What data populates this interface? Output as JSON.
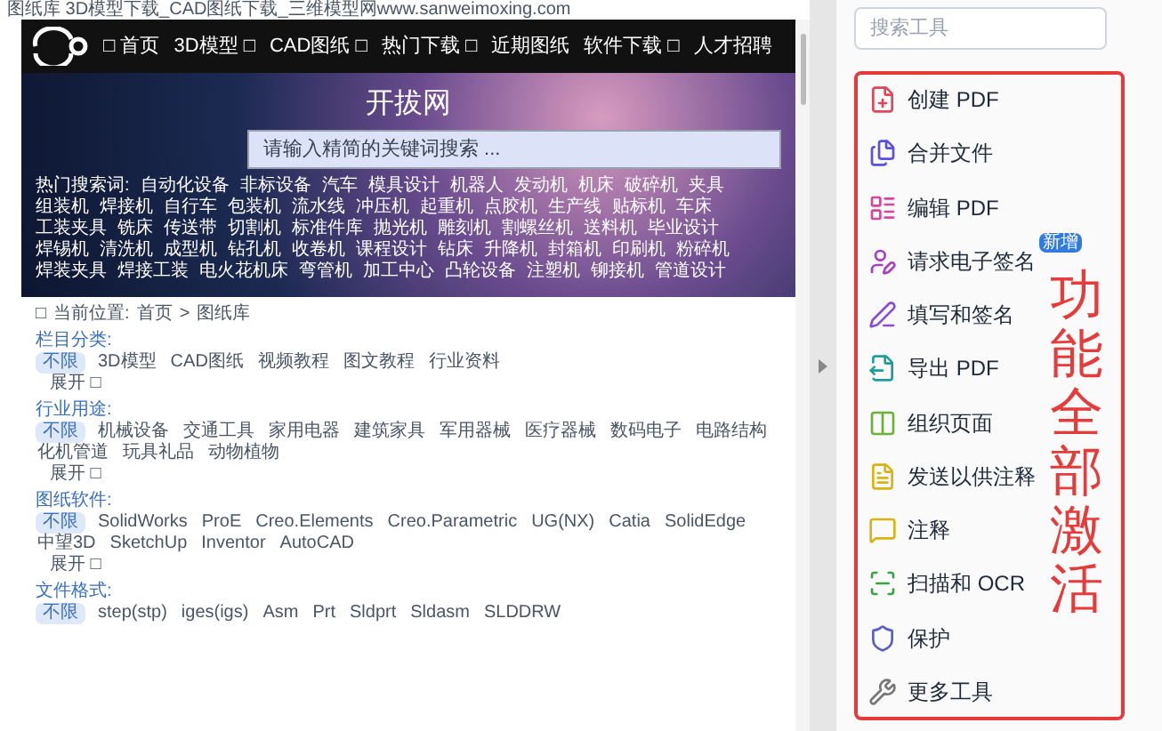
{
  "page_title": "图纸库 3D模型下载_CAD图纸下载_三维模型网www.sanweimoxing.com",
  "nav_items": [
    "□ 首页",
    "3D模型 □",
    "CAD图纸 □",
    "热门下载 □",
    "近期图纸",
    "软件下载 □",
    "人才招聘"
  ],
  "banner_title": "开拔网",
  "search": {
    "placeholder": "请输入精简的关键词搜索 ..."
  },
  "hot_search": {
    "label": "热门搜索词:",
    "terms": [
      "自动化设备",
      "非标设备",
      "汽车",
      "模具设计",
      "机器人",
      "发动机",
      "机床",
      "破碎机",
      "夹具",
      "组装机",
      "焊接机",
      "自行车",
      "包装机",
      "流水线",
      "冲压机",
      "起重机",
      "点胶机",
      "生产线",
      "贴标机",
      "车床",
      "工装夹具",
      "铣床",
      "传送带",
      "切割机",
      "标准件库",
      "抛光机",
      "雕刻机",
      "割螺丝机",
      "送料机",
      "毕业设计",
      "焊锡机",
      "清洗机",
      "成型机",
      "钻孔机",
      "收卷机",
      "课程设计",
      "钻床",
      "升降机",
      "封箱机",
      "印刷机",
      "粉碎机",
      "焊装夹具",
      "焊接工装",
      "电火花机床",
      "弯管机",
      "加工中心",
      "凸轮设备",
      "注塑机",
      "铆接机",
      "管道设计"
    ]
  },
  "breadcrumb": {
    "icon": "□",
    "label": "当前位置:",
    "items": [
      "首页",
      "图纸库"
    ],
    "separator": ">"
  },
  "filters": [
    {
      "title": "栏目分类:",
      "expand": "展开 □",
      "options": [
        {
          "label": "不限",
          "selected": true
        },
        {
          "label": "3D模型",
          "selected": false
        },
        {
          "label": "CAD图纸",
          "selected": false
        },
        {
          "label": "视频教程",
          "selected": false
        },
        {
          "label": "图文教程",
          "selected": false
        },
        {
          "label": "行业资料",
          "selected": false
        }
      ]
    },
    {
      "title": "行业用途:",
      "expand": "展开 □",
      "options": [
        {
          "label": "不限",
          "selected": true
        },
        {
          "label": "机械设备",
          "selected": false
        },
        {
          "label": "交通工具",
          "selected": false
        },
        {
          "label": "家用电器",
          "selected": false
        },
        {
          "label": "建筑家具",
          "selected": false
        },
        {
          "label": "军用器械",
          "selected": false
        },
        {
          "label": "医疗器械",
          "selected": false
        },
        {
          "label": "数码电子",
          "selected": false
        },
        {
          "label": "电路结构",
          "selected": false
        },
        {
          "label": "化机管道",
          "selected": false
        },
        {
          "label": "玩具礼品",
          "selected": false
        },
        {
          "label": "动物植物",
          "selected": false
        }
      ]
    },
    {
      "title": "图纸软件:",
      "expand": "展开 □",
      "options": [
        {
          "label": "不限",
          "selected": true
        },
        {
          "label": "SolidWorks",
          "selected": false
        },
        {
          "label": "ProE",
          "selected": false
        },
        {
          "label": "Creo.Elements",
          "selected": false
        },
        {
          "label": "Creo.Parametric",
          "selected": false
        },
        {
          "label": "UG(NX)",
          "selected": false
        },
        {
          "label": "Catia",
          "selected": false
        },
        {
          "label": "SolidEdge",
          "selected": false
        },
        {
          "label": "中望3D",
          "selected": false
        },
        {
          "label": "SketchUp",
          "selected": false
        },
        {
          "label": "Inventor",
          "selected": false
        },
        {
          "label": "AutoCAD",
          "selected": false
        }
      ]
    },
    {
      "title": "文件格式:",
      "options": [
        {
          "label": "不限",
          "selected": true
        },
        {
          "label": "step(stp)",
          "selected": false
        },
        {
          "label": "iges(igs)",
          "selected": false
        },
        {
          "label": "Asm",
          "selected": false
        },
        {
          "label": "Prt",
          "selected": false
        },
        {
          "label": "Sldprt",
          "selected": false
        },
        {
          "label": "Sldasm",
          "selected": false
        },
        {
          "label": "SLDDRW",
          "selected": false
        }
      ]
    }
  ],
  "tool_search": {
    "placeholder": "搜索工具"
  },
  "tools": [
    {
      "kind": "create",
      "label": "创建 PDF"
    },
    {
      "kind": "combine",
      "label": "合并文件"
    },
    {
      "kind": "edit",
      "label": "编辑 PDF"
    },
    {
      "kind": "request-sign",
      "label": "请求电子签名",
      "badge": "新增"
    },
    {
      "kind": "fill-sign",
      "label": "填写和签名"
    },
    {
      "kind": "export",
      "label": "导出 PDF"
    },
    {
      "kind": "organize",
      "label": "组织页面"
    },
    {
      "kind": "send-comment",
      "label": "发送以供注释"
    },
    {
      "kind": "comment",
      "label": "注释"
    },
    {
      "kind": "scan",
      "label": "扫描和 OCR"
    },
    {
      "kind": "protect",
      "label": "保护"
    },
    {
      "kind": "more",
      "label": "更多工具"
    }
  ],
  "overlay_text": "功能全部激活"
}
